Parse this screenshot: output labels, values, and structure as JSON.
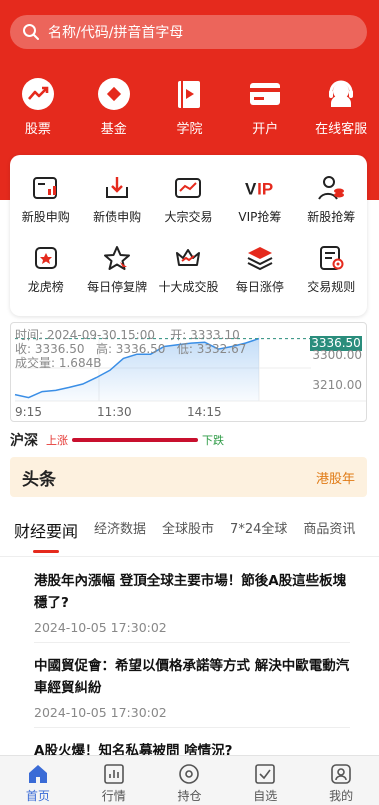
{
  "search": {
    "placeholder": "名称/代码/拼音首字母"
  },
  "top_nav": [
    {
      "label": "股票",
      "icon": "trend-up-icon"
    },
    {
      "label": "基金",
      "icon": "diamond-icon"
    },
    {
      "label": "学院",
      "icon": "book-icon"
    },
    {
      "label": "开户",
      "icon": "card-icon"
    },
    {
      "label": "在线客服",
      "icon": "headset-icon"
    }
  ],
  "grid": [
    {
      "label": "新股申购",
      "icon": "new-stock-icon"
    },
    {
      "label": "新债申购",
      "icon": "bond-download-icon"
    },
    {
      "label": "大宗交易",
      "icon": "block-trade-icon"
    },
    {
      "label": "VIP抢筹",
      "icon": "vip-icon"
    },
    {
      "label": "新股抢筹",
      "icon": "user-coins-icon"
    },
    {
      "label": "龙虎榜",
      "icon": "dragon-tiger-icon"
    },
    {
      "label": "每日停复牌",
      "icon": "star-icon"
    },
    {
      "label": "十大成交股",
      "icon": "crown-icon"
    },
    {
      "label": "每日涨停",
      "icon": "layers-icon"
    },
    {
      "label": "交易规则",
      "icon": "rules-icon"
    }
  ],
  "chart": {
    "time_line": "时间: 2024-09-30 15:00",
    "open_line": "开: 3333.10",
    "close": "收: 3336.50",
    "high": "高: 3336.50",
    "low": "低: 3332.67",
    "volume": "成交量: 1.684B",
    "price_tag": "3336.50",
    "y_top": "3300.00",
    "y_bottom": "3210.00",
    "x_labels": [
      "9:15",
      "11:30",
      "14:15"
    ]
  },
  "chart_data": {
    "type": "area",
    "x": [
      "9:15",
      "9:30",
      "9:45",
      "10:00",
      "10:15",
      "10:30",
      "10:45",
      "11:00",
      "11:15",
      "11:30",
      "13:00",
      "13:15",
      "13:30",
      "13:45",
      "14:00",
      "14:15",
      "14:30",
      "14:45",
      "15:00"
    ],
    "values": [
      3205,
      3198,
      3212,
      3215,
      3222,
      3230,
      3245,
      3262,
      3290,
      3300,
      3300,
      3318,
      3322,
      3326,
      3328,
      3312,
      3318,
      3326,
      3336.5
    ],
    "ylim": [
      3190,
      3345
    ],
    "last": 3336.5,
    "color": "#3a8ee6"
  },
  "market": {
    "label": "沪深",
    "up": "上涨",
    "down": "下跌"
  },
  "banner": {
    "logo": "头条",
    "right": "港股年"
  },
  "tabs": [
    "财经要闻",
    "经济数据",
    "全球股市",
    "7*24全球",
    "商品资讯"
  ],
  "news": [
    {
      "title": "港股年內漲幅 登頂全球主要市場！節後A股這些板塊穩了?",
      "date": "2024-10-05 17:30:02"
    },
    {
      "title": "中國貿促會：希望以價格承諾等方式 解決中歐電動汽車經貿糾紛",
      "date": "2024-10-05 17:30:02"
    },
    {
      "title": "A股火爆！知名私募被問 啥情況?",
      "date": ""
    }
  ],
  "bottom_nav": [
    {
      "label": "首页",
      "icon": "home-icon",
      "active": true
    },
    {
      "label": "行情",
      "icon": "chart-icon",
      "active": false
    },
    {
      "label": "持仓",
      "icon": "compass-icon",
      "active": false
    },
    {
      "label": "自选",
      "icon": "checkbox-icon",
      "active": false
    },
    {
      "label": "我的",
      "icon": "user-icon",
      "active": false
    }
  ],
  "colors": {
    "brand_red": "#e52a1d",
    "accent_blue": "#3a6bd6",
    "up": "#e53935",
    "down": "#2e9b46"
  }
}
